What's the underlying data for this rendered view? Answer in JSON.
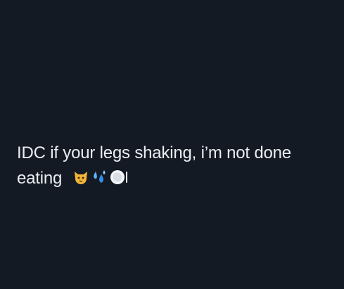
{
  "post": {
    "line1": "IDC if your legs shaking, i’m not done",
    "line2": "eating"
  },
  "emojis": [
    "cat-face-icon",
    "sweat-droplets-icon",
    "plate-icon"
  ],
  "colors": {
    "background": "#141a23",
    "text": "#e9eef3"
  }
}
